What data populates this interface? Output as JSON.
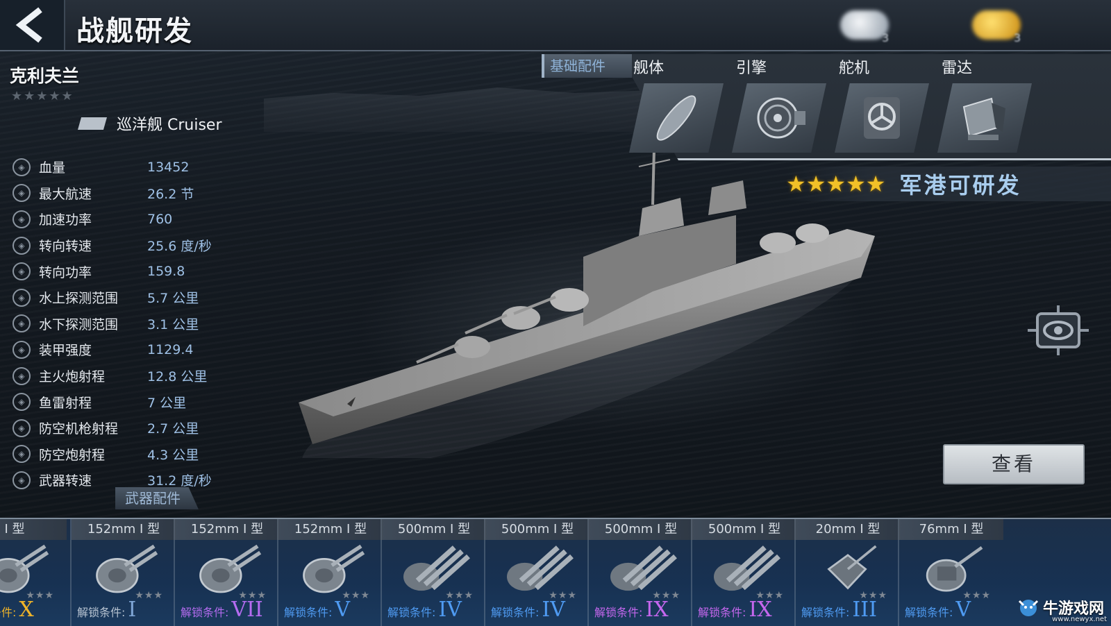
{
  "header": {
    "title": "战舰研发",
    "resource_1": "3",
    "resource_2": "3"
  },
  "ship": {
    "name": "克利夫兰",
    "stars": "★★★★★",
    "class_label": "巡洋舰 Cruiser"
  },
  "stats": [
    {
      "label": "血量",
      "value": "13452"
    },
    {
      "label": "最大航速",
      "value": "26.2 节"
    },
    {
      "label": "加速功率",
      "value": "760"
    },
    {
      "label": "转向转速",
      "value": "25.6 度/秒"
    },
    {
      "label": "转向功率",
      "value": "159.8"
    },
    {
      "label": "水上探测范围",
      "value": "5.7 公里"
    },
    {
      "label": "水下探测范围",
      "value": "3.1 公里"
    },
    {
      "label": "装甲强度",
      "value": "1129.4"
    },
    {
      "label": "主火炮射程",
      "value": "12.8 公里"
    },
    {
      "label": "鱼雷射程",
      "value": "7 公里"
    },
    {
      "label": "防空机枪射程",
      "value": "2.7 公里"
    },
    {
      "label": "防空炮射程",
      "value": "4.3 公里"
    },
    {
      "label": "武器转速",
      "value": "31.2 度/秒"
    }
  ],
  "components": {
    "section_label": "基础配件",
    "items": [
      {
        "label": "舰体",
        "icon": "hull-icon"
      },
      {
        "label": "引擎",
        "icon": "engine-icon"
      },
      {
        "label": "舵机",
        "icon": "steering-icon"
      },
      {
        "label": "雷达",
        "icon": "radar-icon"
      }
    ],
    "rating_stars": "★★★★★",
    "research_status": "军港可研发"
  },
  "view_button": "查看",
  "weapons": {
    "section_label": "武器配件",
    "unlock_label": "解锁条件:",
    "cards": [
      {
        "name": "I 型",
        "tier": "X",
        "tier_color": "#f0b429",
        "label_color": "#f0b429",
        "stars": "★★★",
        "kind": "turret"
      },
      {
        "name": "152mm I 型",
        "tier": "I",
        "tier_color": "#7fa6d6",
        "label_color": "#b8c4d2",
        "stars": "★★★",
        "kind": "turret"
      },
      {
        "name": "152mm I 型",
        "tier": "VII",
        "tier_color": "#b56cf0",
        "label_color": "#b56cf0",
        "stars": "★★★",
        "kind": "turret"
      },
      {
        "name": "152mm I 型",
        "tier": "V",
        "tier_color": "#4f9bf2",
        "label_color": "#4f9bf2",
        "stars": "★★★",
        "kind": "turret"
      },
      {
        "name": "500mm I 型",
        "tier": "IV",
        "tier_color": "#4f9bf2",
        "label_color": "#4f9bf2",
        "stars": "★★★",
        "kind": "torpedo"
      },
      {
        "name": "500mm I 型",
        "tier": "IV",
        "tier_color": "#4f9bf2",
        "label_color": "#4f9bf2",
        "stars": "★★★",
        "kind": "torpedo"
      },
      {
        "name": "500mm I 型",
        "tier": "IX",
        "tier_color": "#c567ee",
        "label_color": "#c567ee",
        "stars": "★★★",
        "kind": "torpedo"
      },
      {
        "name": "500mm I 型",
        "tier": "IX",
        "tier_color": "#c567ee",
        "label_color": "#c567ee",
        "stars": "★★★",
        "kind": "torpedo"
      },
      {
        "name": "20mm I 型",
        "tier": "III",
        "tier_color": "#4f9bf2",
        "label_color": "#4f9bf2",
        "stars": "★★★",
        "kind": "aa"
      },
      {
        "name": "76mm I 型",
        "tier": "V",
        "tier_color": "#4f9bf2",
        "label_color": "#4f9bf2",
        "stars": "★★★",
        "kind": "aa-gun"
      }
    ]
  },
  "watermark": {
    "text": "牛游戏网",
    "url": "www.newyx.net"
  }
}
